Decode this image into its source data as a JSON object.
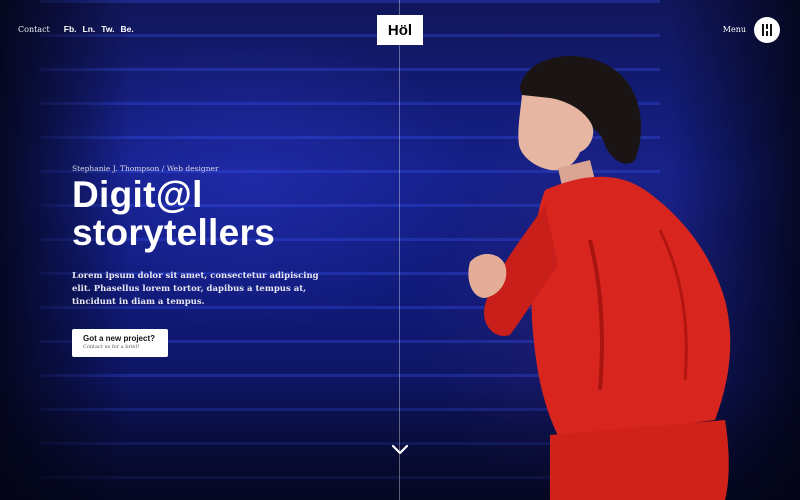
{
  "header": {
    "contact_label": "Contact",
    "social_links": [
      "Fb.",
      "Ln.",
      "Tw.",
      "Be."
    ],
    "logo_text": "Höl",
    "menu_label": "Menu"
  },
  "hero": {
    "eyebrow": "Stephanie J. Thompson / Web designer",
    "headline_line1": "Digit@l",
    "headline_line2": "storytellers",
    "intro": "Lorem ipsum dolor sit amet, consectetur adipiscing elit. Phasellus lorem tortor, dapibus a tempus at, tincidunt in diam a tempus.",
    "cta_title": "Got a new project?",
    "cta_subtitle": "Contact us for a brief!"
  },
  "icons": {
    "menu": "menu-dots-icon",
    "scroll": "chevron-down-icon"
  },
  "colors": {
    "background_blue": "#14208a",
    "accent_red": "#d8261f",
    "logo_bg": "#ffffff"
  }
}
